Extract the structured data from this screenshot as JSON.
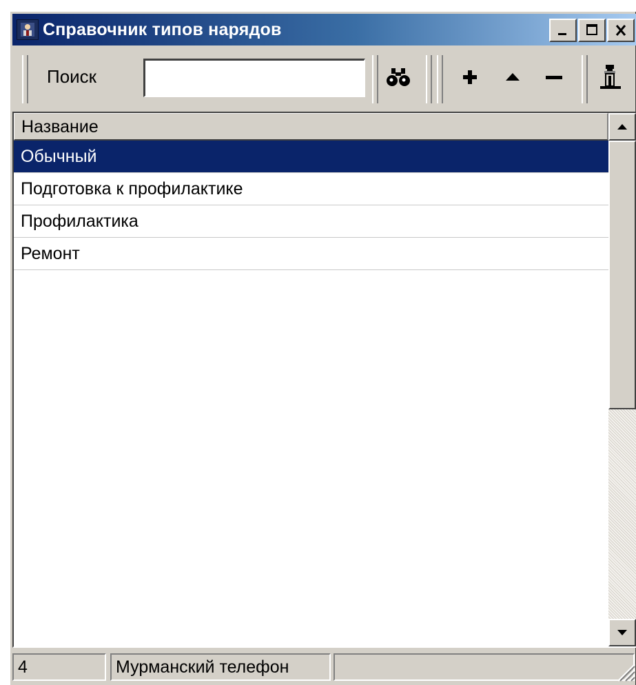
{
  "window": {
    "title": "Справочник типов нарядов",
    "controls": {
      "minimize": "minimize",
      "maximize": "maximize",
      "close": "close"
    }
  },
  "toolbar": {
    "search_label": "Поиск",
    "search_value": "",
    "buttons": [
      {
        "name": "find",
        "icon": "binoculars-icon"
      },
      {
        "name": "add",
        "icon": "plus-icon"
      },
      {
        "name": "edit",
        "icon": "triangle-up-icon"
      },
      {
        "name": "delete",
        "icon": "minus-icon"
      },
      {
        "name": "exit",
        "icon": "door-exit-icon"
      }
    ]
  },
  "list": {
    "column_header": "Название",
    "rows": [
      {
        "label": "Обычный",
        "selected": true
      },
      {
        "label": "Подготовка к профилактике",
        "selected": false
      },
      {
        "label": "Профилактика",
        "selected": false
      },
      {
        "label": "Ремонт",
        "selected": false
      }
    ]
  },
  "status": {
    "count": "4",
    "company": "Мурманский телефон",
    "extra": ""
  },
  "colors": {
    "selection": "#0a246a",
    "titlebar_start": "#0a246a",
    "titlebar_end": "#a6caf0",
    "face": "#d4d0c8"
  }
}
